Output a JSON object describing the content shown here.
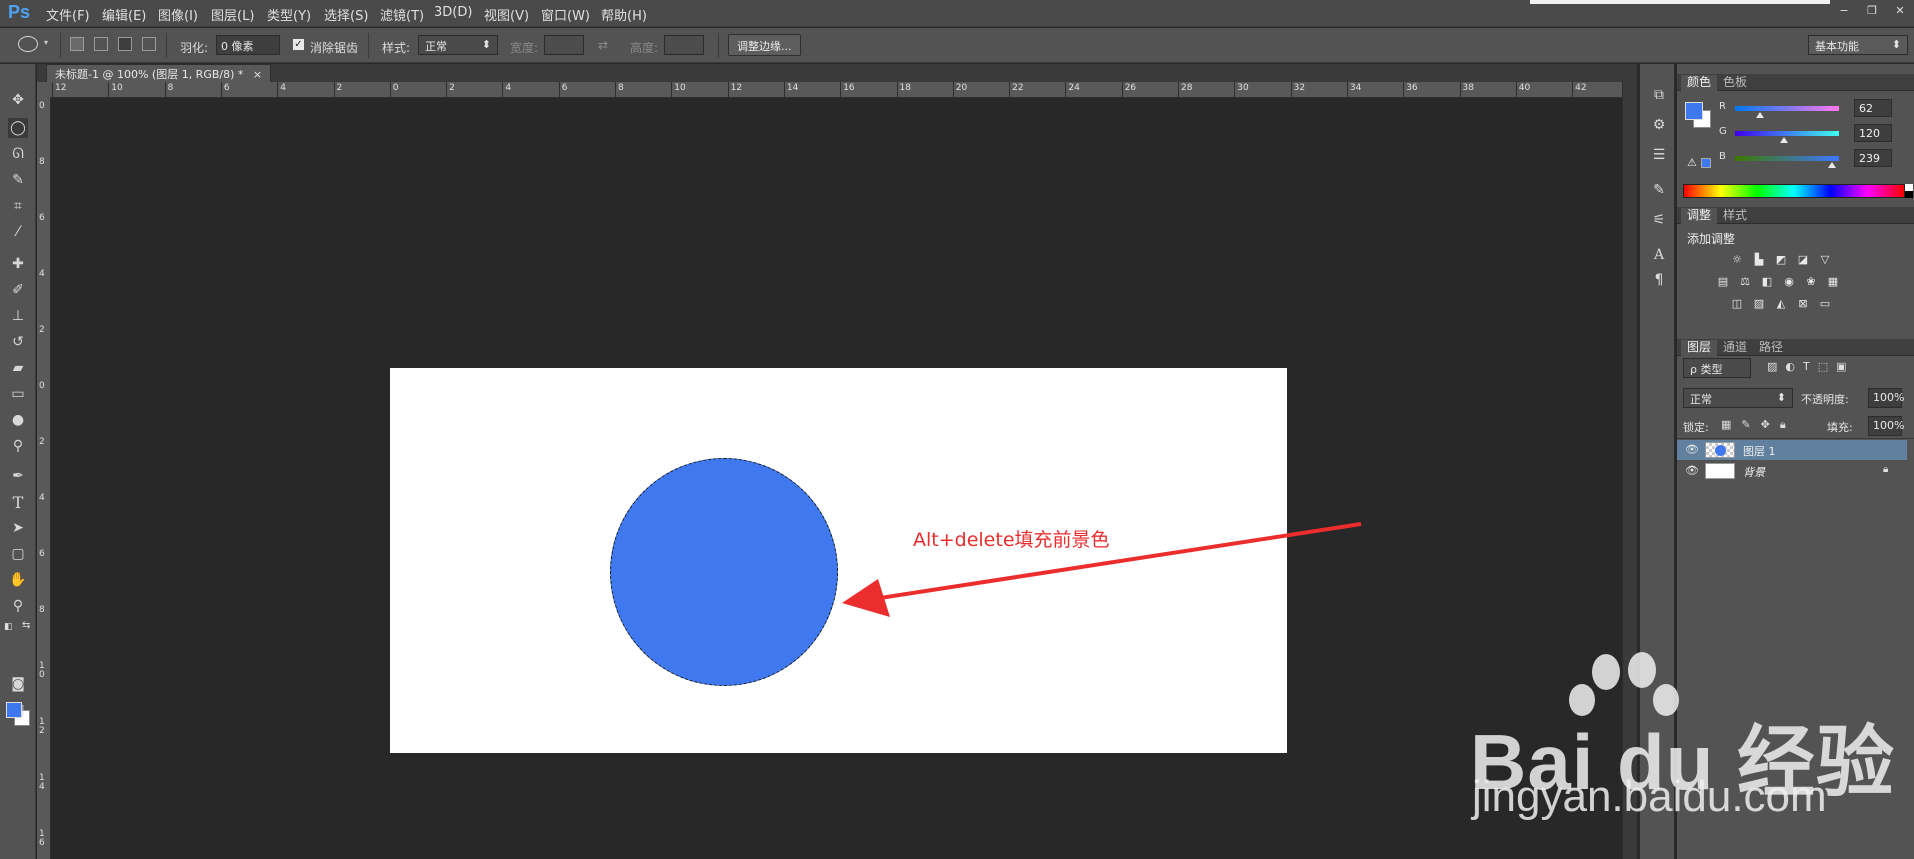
{
  "app": {
    "logo": "Ps"
  },
  "menu": [
    "文件(F)",
    "编辑(E)",
    "图像(I)",
    "图层(L)",
    "类型(Y)",
    "选择(S)",
    "滤镜(T)",
    "3D(D)",
    "视图(V)",
    "窗口(W)",
    "帮助(H)"
  ],
  "window_controls": [
    "−",
    "❐",
    "✕"
  ],
  "options_bar": {
    "feather_label": "羽化:",
    "feather_value": "0 像素",
    "antialias_label": "消除锯齿",
    "antialias_checked": true,
    "style_label": "样式:",
    "style_value": "正常",
    "width_label": "宽度:",
    "height_label": "高度:",
    "refine_edge_button": "调整边缘...",
    "workspace": "基本功能"
  },
  "document_tab": {
    "title": "未标题-1 @ 100% (图层 1, RGB/8) *",
    "close": "×"
  },
  "ruler_h_labels": [
    "12",
    "10",
    "8",
    "6",
    "4",
    "2",
    "0",
    "2",
    "4",
    "6",
    "8",
    "10",
    "12",
    "14",
    "16",
    "18",
    "20",
    "22",
    "24",
    "26",
    "28",
    "30",
    "32",
    "34",
    "36",
    "38",
    "40",
    "42"
  ],
  "ruler_v_labels": [
    "0",
    "8",
    "6",
    "4",
    "2",
    "0",
    "2",
    "4",
    "6",
    "8",
    "1 0",
    "1 2",
    "1 4",
    "1 6"
  ],
  "canvas": {
    "annotation": "Alt+delete填充前景色",
    "fill_color": "#4079ef",
    "annotation_color": "#ec2d2d"
  },
  "colors": {
    "foreground": "#3e78ef",
    "background": "#ffffff"
  },
  "color_panel": {
    "tabs": [
      "颜色",
      "色板"
    ],
    "channels": [
      {
        "label": "R",
        "value": "62",
        "fraction": 0.243
      },
      {
        "label": "G",
        "value": "120",
        "fraction": 0.471
      },
      {
        "label": "B",
        "value": "239",
        "fraction": 0.937
      }
    ]
  },
  "adjustments_panel": {
    "tabs": [
      "调整",
      "样式"
    ],
    "title": "添加调整",
    "icon_rows": [
      [
        "brightness-icon",
        "levels-icon",
        "curves-icon",
        "exposure-icon",
        "vibrance-icon"
      ],
      [
        "hue-saturation-icon",
        "color-balance-icon",
        "black-white-icon",
        "photo-filter-icon",
        "channel-mixer-icon",
        "color-lookup-icon"
      ],
      [
        "invert-icon",
        "posterize-icon",
        "threshold-icon",
        "selective-color-icon",
        "gradient-map-icon"
      ]
    ]
  },
  "layers_panel": {
    "tabs": [
      "图层",
      "通道",
      "路径"
    ],
    "filter_label": "ρ 类型",
    "blend_mode": "正常",
    "opacity_label": "不透明度:",
    "opacity_value": "100%",
    "lock_label": "锁定:",
    "fill_label": "填充:",
    "fill_value": "100%",
    "layers": [
      {
        "name": "图层 1",
        "selected": true
      },
      {
        "name": "背景",
        "selected": false,
        "locked": true
      }
    ]
  },
  "watermark": {
    "brand": "Bai du 经验",
    "url": "jingyan.baidu.com"
  }
}
